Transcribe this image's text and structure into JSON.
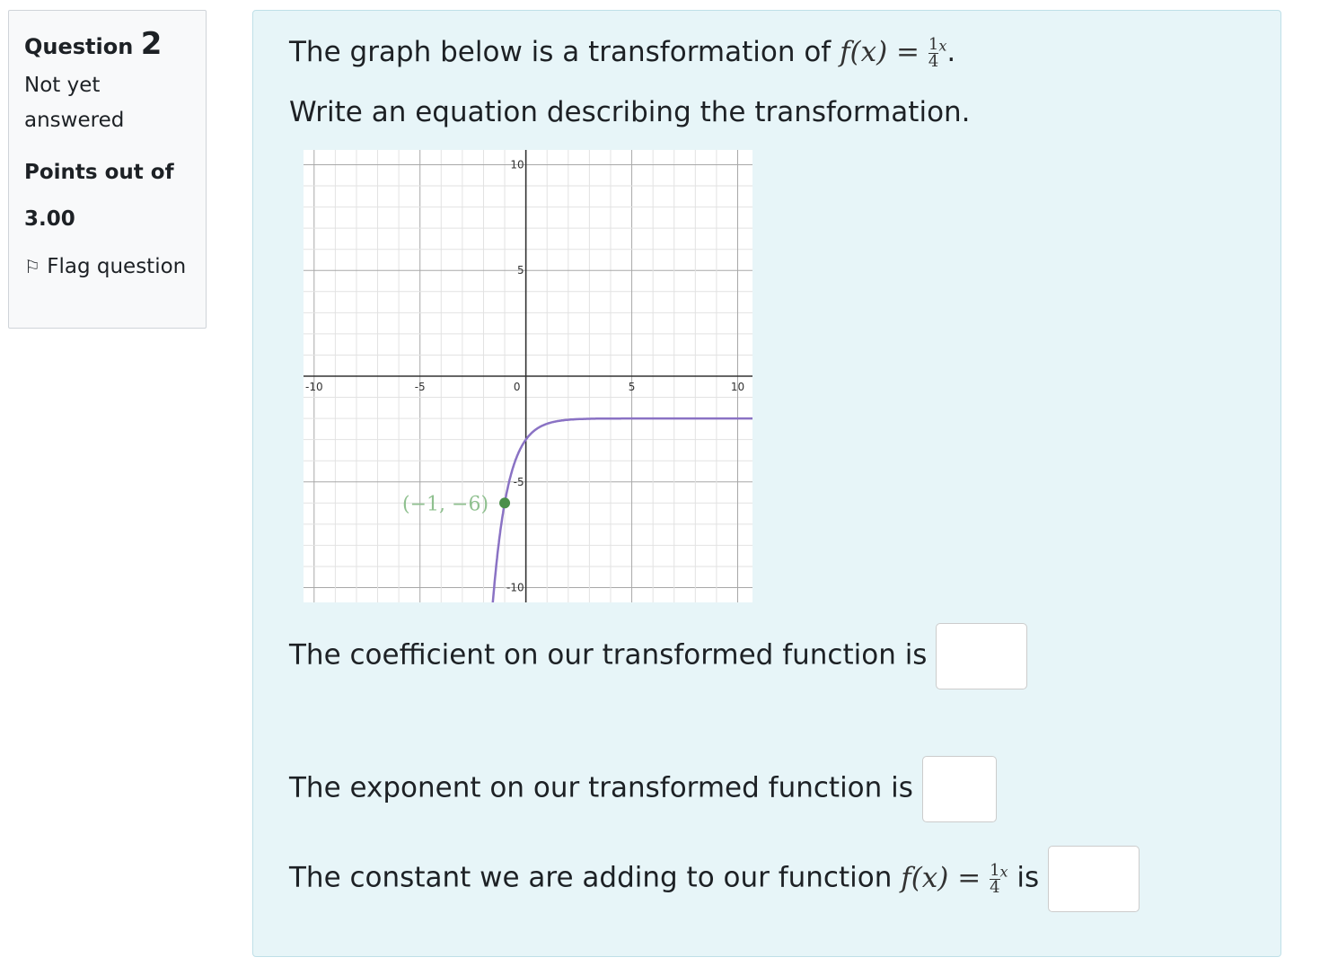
{
  "info": {
    "question_label": "Question",
    "question_number": "2",
    "state": "Not yet answered",
    "grade": "Points out of 3.00",
    "flag_label": "Flag question",
    "flag_icon": "flag-outline-icon"
  },
  "question": {
    "intro_text": "The graph below is a transformation of",
    "function_text": "f(x) =",
    "base_num": "1",
    "base_den": "4",
    "exponent": "x",
    "instruction": "Write an equation describing the transformation.",
    "coefficient_prompt": "The coefficient on our transformed function is",
    "exponent_prompt": "The exponent on our transformed function is",
    "constant_prompt": "The constant we are adding to our function",
    "constant_suffix": "is",
    "coefficient_value": "",
    "exponent_value": "",
    "constant_value": ""
  },
  "chart_data": {
    "type": "line",
    "xlim": [
      -10.5,
      10.7
    ],
    "ylim": [
      -10.7,
      10.7
    ],
    "grid": true,
    "x_ticks": [
      "-10",
      "-5",
      "0",
      "5",
      "10"
    ],
    "y_ticks": [
      "10",
      "5",
      "-5",
      "-10"
    ],
    "curve_color": "#8a72c4",
    "point_color": "#4a8f4a",
    "label_color": "#8fc08f",
    "curve": {
      "a": -1,
      "b": 0.25,
      "k": -2
    },
    "point": {
      "x": -1,
      "y": -6,
      "label": "(−1, −6)"
    }
  }
}
